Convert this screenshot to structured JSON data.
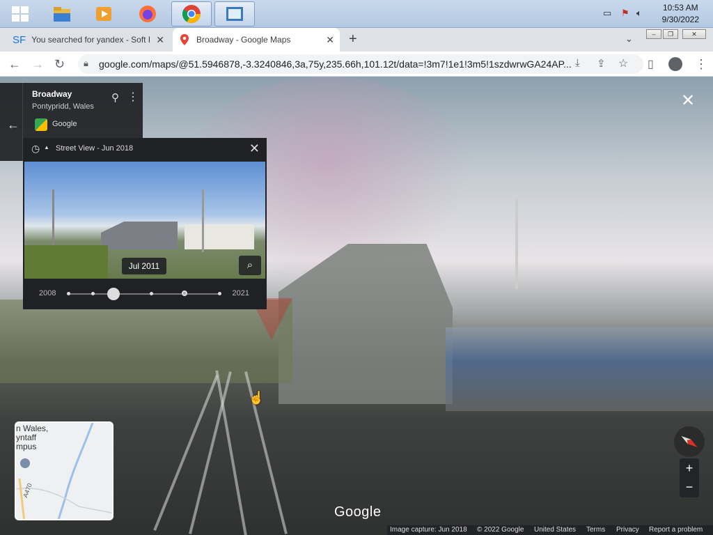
{
  "taskbar": {
    "apps": [
      {
        "name": "windows-start",
        "icon": "windows-logo-icon"
      },
      {
        "name": "file-explorer",
        "icon": "folder-icon"
      },
      {
        "name": "media-player",
        "icon": "media-icon"
      },
      {
        "name": "firefox",
        "icon": "firefox-icon"
      },
      {
        "name": "chrome",
        "icon": "chrome-icon"
      },
      {
        "name": "app",
        "icon": "app-icon"
      }
    ],
    "clock_time": "10:53 AM",
    "clock_date": "9/30/2022"
  },
  "browser": {
    "tabs": [
      {
        "label": "You searched for yandex - Soft F",
        "favicon": "SF",
        "active": false
      },
      {
        "label": "Broadway - Google Maps",
        "favicon": "maps-pin",
        "active": true
      }
    ],
    "new_tab_label": "+",
    "url": "google.com/maps/@51.5946878,-3.3240846,3a,75y,235.66h,101.12t/data=!3m7!1e1!3m5!1szdwrwGA24AP..."
  },
  "place_card": {
    "title": "Broadway",
    "subtitle": "Pontypridd, Wales",
    "provider": "Google"
  },
  "timeline": {
    "title": "Street View - Jun 2018",
    "selected_label": "Jul 2011",
    "start_year": "2008",
    "end_year": "2021"
  },
  "minimap": {
    "label": "n Wales,\nyntaff\nmpus",
    "road": "A470"
  },
  "zoom": {
    "in": "+",
    "out": "−"
  },
  "watermark": "Google",
  "footer": {
    "capture": "Image capture: Jun 2018",
    "copyright": "© 2022 Google",
    "region": "United States",
    "terms": "Terms",
    "privacy": "Privacy",
    "report": "Report a problem"
  }
}
